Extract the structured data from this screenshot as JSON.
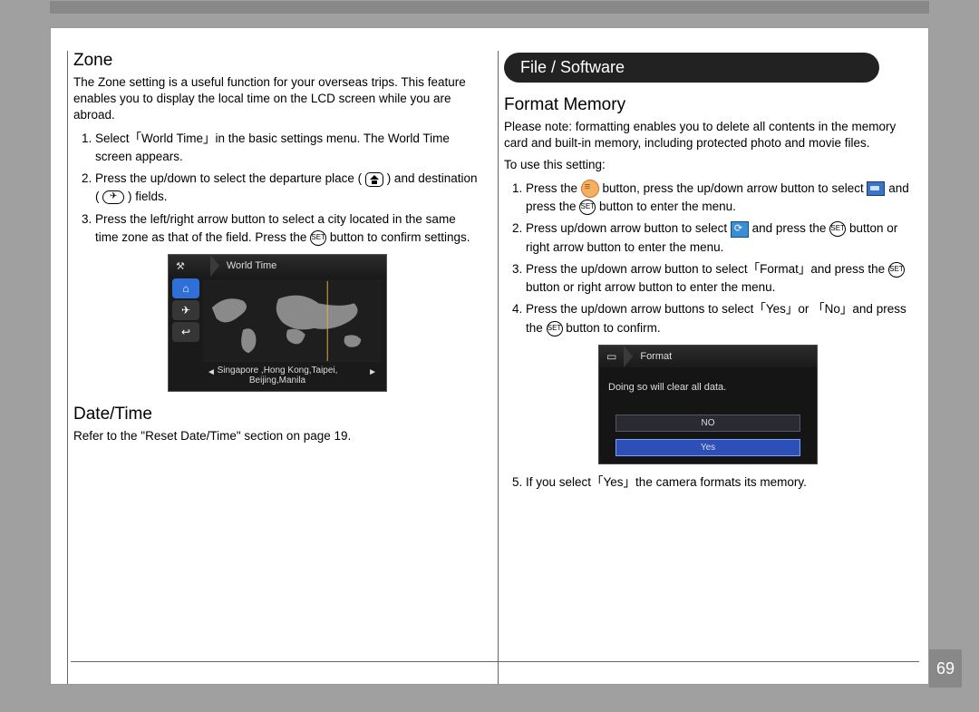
{
  "page_number": "69",
  "left": {
    "zone": {
      "heading": "Zone",
      "intro": "The Zone setting is a useful function for your overseas trips. This feature enables you to display the local time on the LCD screen while you are abroad.",
      "steps": [
        "Select「World Time」in the basic settings menu. The World Time screen appears.",
        "Press the up/down to select the departure place ( home ) and destination ( plane ) fields.",
        "Press the left/right arrow button to select a city located in the same time zone as that of the field. Press the SET button to confirm settings."
      ],
      "lcd": {
        "title": "World Time",
        "cities_line1": "Singapore ,Hong Kong,Taipei,",
        "cities_line2": "Beijing,Manila"
      }
    },
    "datetime": {
      "heading": "Date/Time",
      "text": "Refer to the \"Reset Date/Time\" section on page 19."
    }
  },
  "right": {
    "pill": "File / Software",
    "format": {
      "heading": "Format Memory",
      "intro": "Please note: formatting enables you to delete all contents in the memory card and built-in memory, including protected photo and movie files.",
      "use": "To use this setting:",
      "steps": {
        "s1a": "Press the ",
        "s1b": " button, press the up/down arrow button to select ",
        "s1c": " and press the ",
        "s1d": " button to enter the menu.",
        "s2a": "Press up/down arrow button to select ",
        "s2b": " and press the ",
        "s2c": " button or right arrow button to enter the menu.",
        "s3a": "Press the up/down arrow button to select「Format」and press the ",
        "s3b": " button or right arrow button to enter the menu.",
        "s4a": "Press the up/down arrow buttons to select「Yes」or 「No」and press the ",
        "s4b": " button to confirm."
      },
      "lcd": {
        "title": "Format",
        "msg": "Doing so will clear all data.",
        "opt_no": "NO",
        "opt_yes": "Yes"
      },
      "step5": "If you select「Yes」the camera formats its memory."
    }
  }
}
